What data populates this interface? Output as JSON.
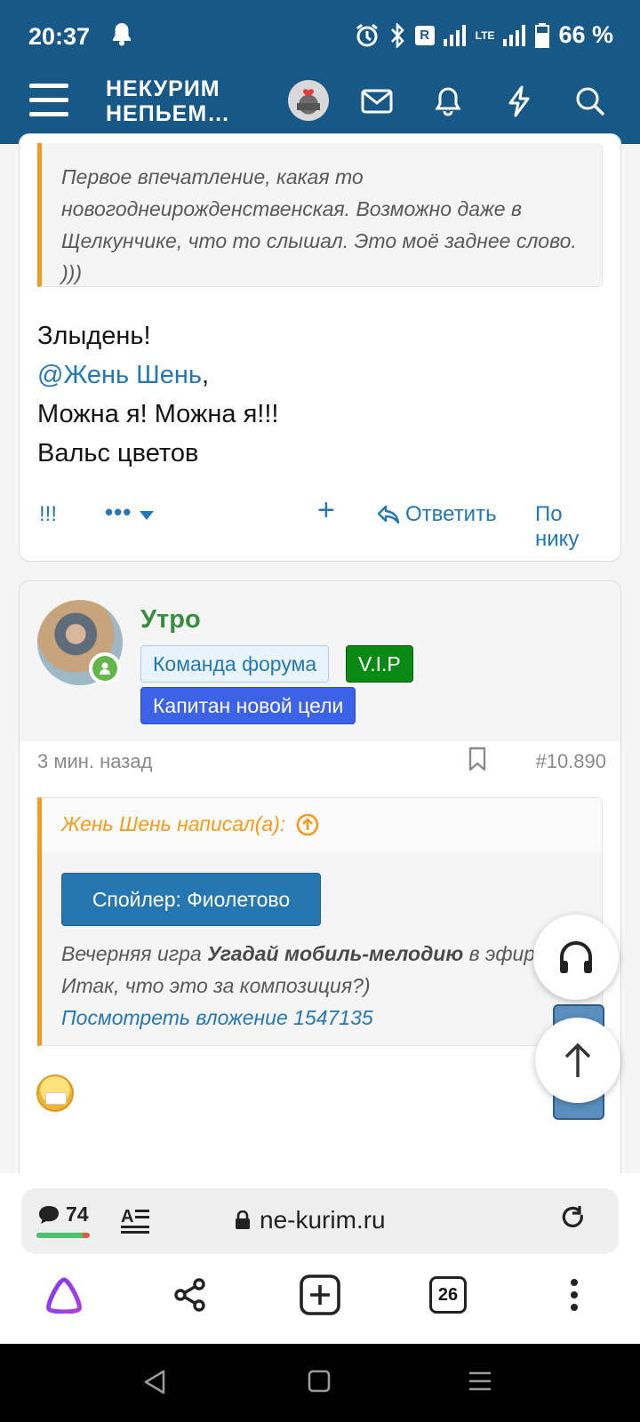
{
  "status_bar": {
    "time": "20:37",
    "r_badge": "R",
    "lte": "LTE",
    "battery": "66 %"
  },
  "header": {
    "brand_line1": "НЕКУРИМ",
    "brand_line2": "НЕПЬЕМ…"
  },
  "post1": {
    "quote_text": "Первое впечатление, какая то новогоднеирожденственская. Возможно даже в Щелкунчике, что то слышал. Это моё заднее слово. )))",
    "line1": "Злыдень!",
    "mention": "@Жень Шень",
    "mention_suffix": ",",
    "line3": "Можна я! Можна я!!!",
    "line4": "Вальс цветов",
    "actions": {
      "exclaim": "!!!",
      "more": "•••",
      "plus": "+",
      "reply": "Ответить",
      "by_nick": "По нику"
    }
  },
  "post2": {
    "username": "Утро",
    "badges": {
      "team": "Команда форума",
      "vip": "V.I.P",
      "captain": "Капитан новой цели"
    },
    "time": "3 мин. назад",
    "number": "#10.890",
    "quote_author": "Жень Шень написал(а):",
    "spoiler": "Спойлер: Фиолетово",
    "text_pre": "Вечерняя игра ",
    "text_bold": "Угадай мобиль-мелодию",
    "text_post": " в эфире",
    "line2": "Итак, что это за композиция?)",
    "attachment_link": "Посмотреть вложение 1547135"
  },
  "browser": {
    "comments": "74",
    "reader_label": "A",
    "url": "ne-kurim.ru",
    "tabs": "26"
  },
  "colors": {
    "primary": "#185886",
    "link": "#2577b1",
    "quote_border": "#f29c1f",
    "username": "#3a8a3f"
  }
}
